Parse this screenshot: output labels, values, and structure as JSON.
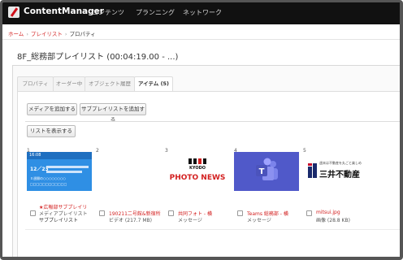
{
  "app": {
    "brand": "ContentManager",
    "nav": [
      "コンテンツ",
      "プランニング",
      "ネットワーク"
    ]
  },
  "breadcrumb": [
    "ホーム",
    "プレイリスト",
    "プロパティ"
  ],
  "page_title": "8F_総務部プレイリスト (00:04:19.00 - ...)",
  "tabs": [
    "プロパティ",
    "オーダー中",
    "オブジェクト履歴",
    "アイテム (5)"
  ],
  "buttons": {
    "add_media": "メディアを追加する",
    "add_subplaylist": "サブプレイリストを追加する",
    "show_list": "リストを表示する"
  },
  "items": [
    {
      "index": "1",
      "title": "★広報部サブプレイリ",
      "subtitle": "メディアプレイリスト",
      "extra": "サブプレイリスト",
      "thumb": {
        "hour": "16:08",
        "date": "12／23",
        "line1": "Ｘ週間の○○○○○○○○",
        "line2": "□□□□□□□□□□□□"
      }
    },
    {
      "index": "2",
      "title": "190211二号館&新宿所",
      "subtitle": "ビデオ (217.7 MB)"
    },
    {
      "index": "3",
      "title": "共同フォト - 横",
      "subtitle": "メッセージ",
      "thumb": {
        "logo": "KYODO",
        "text": "PHOTO NEWS"
      }
    },
    {
      "index": "4",
      "title": "Teams 総務部 - 横",
      "subtitle": "メッセージ"
    },
    {
      "index": "5",
      "title": "mitsui.jpg",
      "subtitle": "画像 (28.8 KB)",
      "thumb": {
        "tagline": "週末は不動産を丸ごと楽しめ",
        "name": "三井不動産"
      }
    }
  ],
  "colors": {
    "topbar": "#111111",
    "brand_red": "#d0101a",
    "link_red": "#d32020",
    "teams_purple": "#5059c9",
    "screen_blue": "#2f8fe4"
  }
}
